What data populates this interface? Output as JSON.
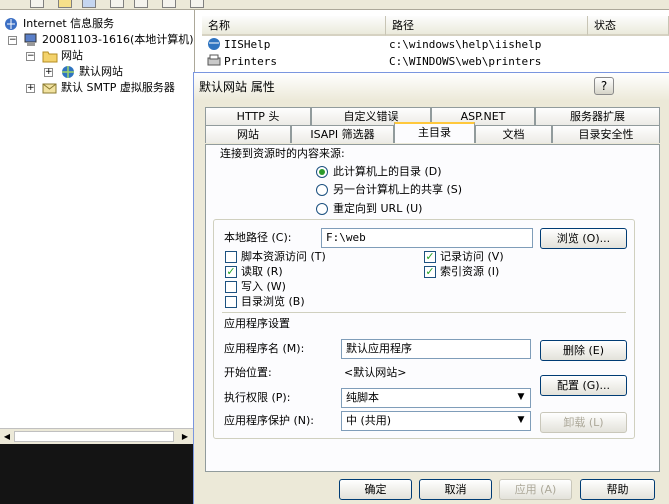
{
  "tree": {
    "root": "Internet 信息服务",
    "computer": "20081103-1616(本地计算机)",
    "websites": "网站",
    "default_site": "默认网站",
    "smtp": "默认 SMTP 虚拟服务器"
  },
  "list": {
    "columns": [
      "名称",
      "路径",
      "状态"
    ],
    "rows": [
      {
        "name": "IISHelp",
        "path": "c:\\windows\\help\\iishelp"
      },
      {
        "name": "Printers",
        "path": "C:\\WINDOWS\\web\\printers"
      }
    ]
  },
  "dialog": {
    "title": "默认网站 属性",
    "help": "?",
    "tabs_row1": [
      "HTTP 头",
      "自定义错误",
      "ASP.NET",
      "服务器扩展"
    ],
    "tabs_row2": [
      "网站",
      "ISAPI 筛选器",
      "主目录",
      "文档",
      "目录安全性"
    ],
    "source_label": "连接到资源时的内容来源:",
    "radios": [
      "此计算机上的目录 (D)",
      "另一台计算机上的共享 (S)",
      "重定向到 URL (U)"
    ],
    "local_path_label": "本地路径 (C):",
    "local_path_value": "F:\\web",
    "browse_button": "浏览 (O)...",
    "checks": {
      "script_source": "脚本资源访问 (T)",
      "read": "读取 (R)",
      "write": "写入 (W)",
      "dir_browse": "目录浏览 (B)",
      "log_visits": "记录访问 (V)",
      "index": "索引资源 (I)"
    },
    "app_settings": "应用程序设置",
    "app_name_label": "应用程序名 (M):",
    "app_name_value": "默认应用程序",
    "remove_button": "删除 (E)",
    "start_label": "开始位置:",
    "start_value": "<默认网站>",
    "config_button": "配置 (G)...",
    "exec_label": "执行权限 (P):",
    "exec_value": "纯脚本",
    "protect_label": "应用程序保护 (N):",
    "protect_value": "中 (共用)",
    "unload_button": "卸载 (L)",
    "ok": "确定",
    "cancel": "取消",
    "apply": "应用 (A)",
    "help_button": "帮助"
  }
}
